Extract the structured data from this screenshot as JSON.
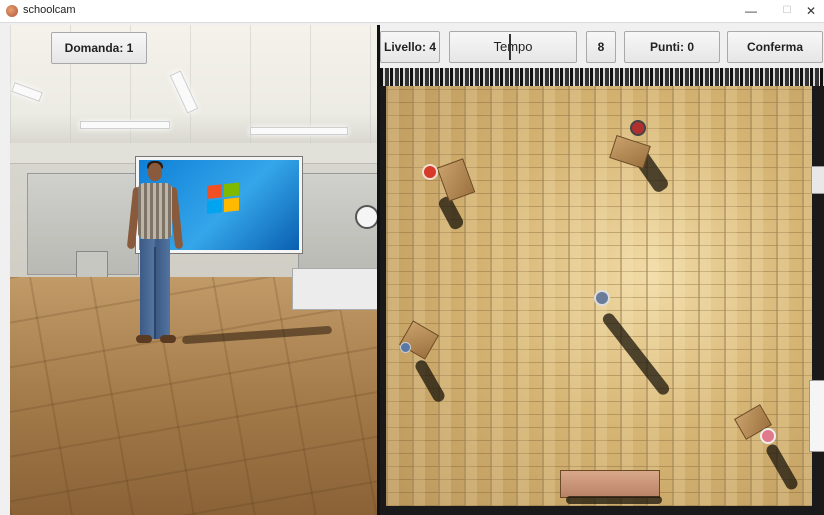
{
  "window": {
    "title": "schoolcam",
    "minimize_glyph": "—",
    "maximize_glyph": "☐",
    "close_glyph": "✕"
  },
  "left_panel": {
    "question_label": "Domanda: 1"
  },
  "top_bar": {
    "level_label": "Livello: 4",
    "time_label": "Tempo",
    "time_progress": 0.4,
    "count_label": "8",
    "points_label": "Punti: 0",
    "confirm_label": "Conferma"
  },
  "colors": {
    "accent_dark": "#111111",
    "floor_wood": "#d6b574",
    "screen_blue": "#1f8fe0"
  },
  "icons": [
    "app-icon",
    "minimize-icon",
    "maximize-icon",
    "close-icon",
    "windows-logo-icon",
    "wall-clock-icon"
  ]
}
